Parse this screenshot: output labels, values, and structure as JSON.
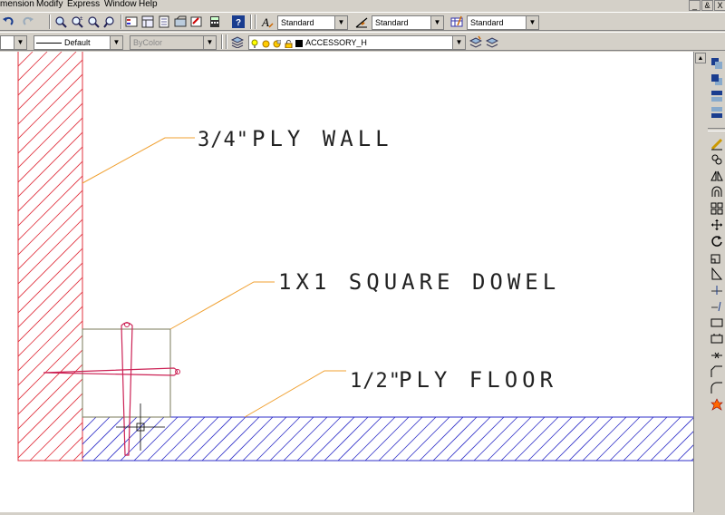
{
  "menu": [
    "mension",
    "Modify",
    "Express",
    "Window",
    "Help"
  ],
  "window_controls": [
    "_",
    "&",
    "X"
  ],
  "toolbar1": {
    "text_style": "Standard",
    "dim_style": "Standard",
    "table_style": "Standard"
  },
  "toolbar2": {
    "linetype": "Default",
    "lineweight": "ByColor",
    "layer": "ACCESSORY_H"
  },
  "drawing": {
    "label_wall": "PLY WALL",
    "label_dowel": "1X1 SQUARE DOWEL",
    "label_floor": "PLY FLOOR",
    "frac_wall": "3/4\"",
    "frac_floor": "1/2\""
  },
  "colors": {
    "wall_hatch": "#e0303c",
    "floor_hatch": "#2f2fc8",
    "leader": "#f0a030",
    "dowel_outline": "#7a7a5a",
    "marker": "#cc2255"
  },
  "icons": {
    "toolbar1": [
      "undo-icon",
      "redo-icon",
      "pan-icon",
      "zoom-realtime-icon",
      "zoom-window-icon",
      "zoom-previous-icon",
      "properties-icon",
      "design-center-icon",
      "tool-palettes-icon",
      "sheet-set-icon",
      "markup-icon",
      "calculator-icon",
      "help-icon",
      "text-style-icon",
      "dim-style-icon",
      "table-style-icon"
    ],
    "toolbar2": [
      "layer-manager-icon",
      "layer-state-icon",
      "layer-previous-icon"
    ],
    "right": [
      "draworder-icon",
      "bring-front-icon",
      "send-back-icon",
      "above-icon",
      "erase-icon",
      "copy-icon",
      "mirror-icon",
      "offset-icon",
      "array-icon",
      "move-icon",
      "rotate-icon",
      "scale-icon",
      "stretch-icon",
      "trim-icon",
      "extend-icon",
      "break-icon",
      "break-at-icon",
      "join-icon",
      "chamfer-icon",
      "fillet-icon",
      "explode-icon"
    ]
  }
}
